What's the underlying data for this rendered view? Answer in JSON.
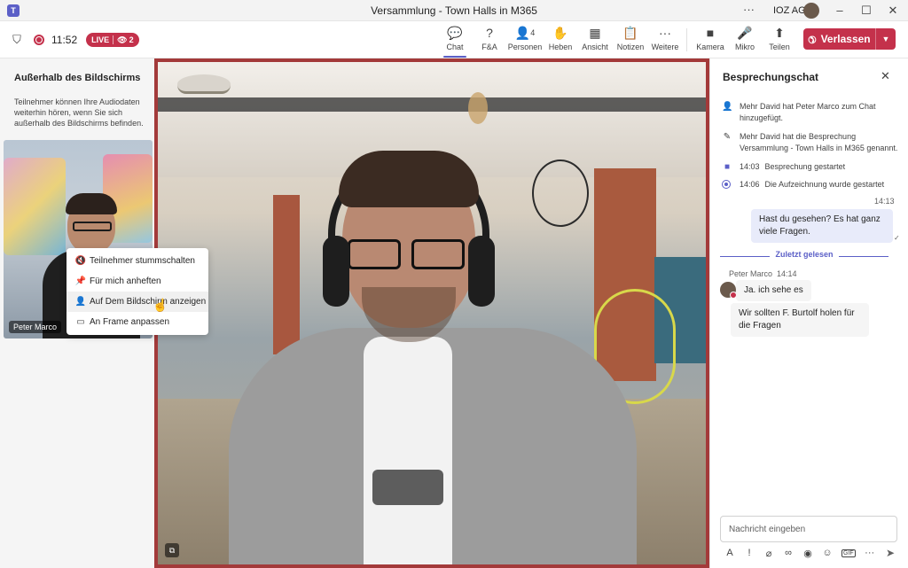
{
  "window": {
    "title": "Versammlung - Town Halls in M365",
    "more": "···",
    "org": "IOZ AG",
    "minimize": "–",
    "maximize": "☐",
    "close": "✕"
  },
  "toolbar": {
    "time": "11:52",
    "live_label": "LIVE",
    "viewers": "2",
    "tools": [
      {
        "label": "Chat",
        "icon": "chat-icon",
        "glyph": "💬"
      },
      {
        "label": "F&A",
        "icon": "qa-icon",
        "glyph": "?"
      },
      {
        "label": "Personen",
        "icon": "people-icon",
        "glyph": "👤",
        "count": "4"
      },
      {
        "label": "Heben",
        "icon": "raise-hand-icon",
        "glyph": "✋"
      },
      {
        "label": "Ansicht",
        "icon": "view-icon",
        "glyph": "▦"
      },
      {
        "label": "Notizen",
        "icon": "notes-icon",
        "glyph": "📋"
      },
      {
        "label": "Weitere",
        "icon": "more-icon",
        "glyph": "···"
      },
      {
        "label": "Kamera",
        "icon": "camera-icon",
        "glyph": "■"
      },
      {
        "label": "Mikro",
        "icon": "mic-icon",
        "glyph": "🎤"
      },
      {
        "label": "Teilen",
        "icon": "share-icon",
        "glyph": "⬆"
      }
    ],
    "leave_label": "Verlassen"
  },
  "off_screen": {
    "title": "Außerhalb des Bildschirms",
    "description": "Teilnehmer können Ihre Audiodaten weiterhin hören, wenn Sie sich außerhalb des Bildschirms befinden.",
    "participant_name": "Peter Marco"
  },
  "context_menu": {
    "items": [
      {
        "label": "Teilnehmer stummschalten",
        "icon": "mic-off-icon"
      },
      {
        "label": "Für mich anheften",
        "icon": "pin-icon"
      },
      {
        "label": "Auf Dem Bildschirm anzeigen",
        "icon": "person-screen-icon"
      },
      {
        "label": "An Frame anpassen",
        "icon": "fit-frame-icon"
      }
    ]
  },
  "chat": {
    "title": "Besprechungschat",
    "system_messages": [
      {
        "text": "Mehr David hat Peter Marco zum Chat hinzugefügt."
      },
      {
        "text": "Mehr David hat die Besprechung Versammlung - Town Halls in M365 genannt."
      },
      {
        "time": "14:03",
        "text": "Besprechung gestartet"
      },
      {
        "time": "14:06",
        "text": "Die Aufzeichnung wurde gestartet"
      }
    ],
    "my_message": {
      "time": "14:13",
      "text": "Hast du gesehen? Es hat ganz viele Fragen."
    },
    "read_marker": "Zuletzt gelesen",
    "their_sender": "Peter Marco",
    "their_time": "14:14",
    "their_messages": [
      "Ja. ich sehe es",
      "Wir sollten F. Burtolf holen für die Fragen"
    ],
    "compose_placeholder": "Nachricht eingeben"
  },
  "colors": {
    "accent": "#5b5fc7",
    "leave": "#c4314b",
    "video_border": "#a33a3a"
  }
}
